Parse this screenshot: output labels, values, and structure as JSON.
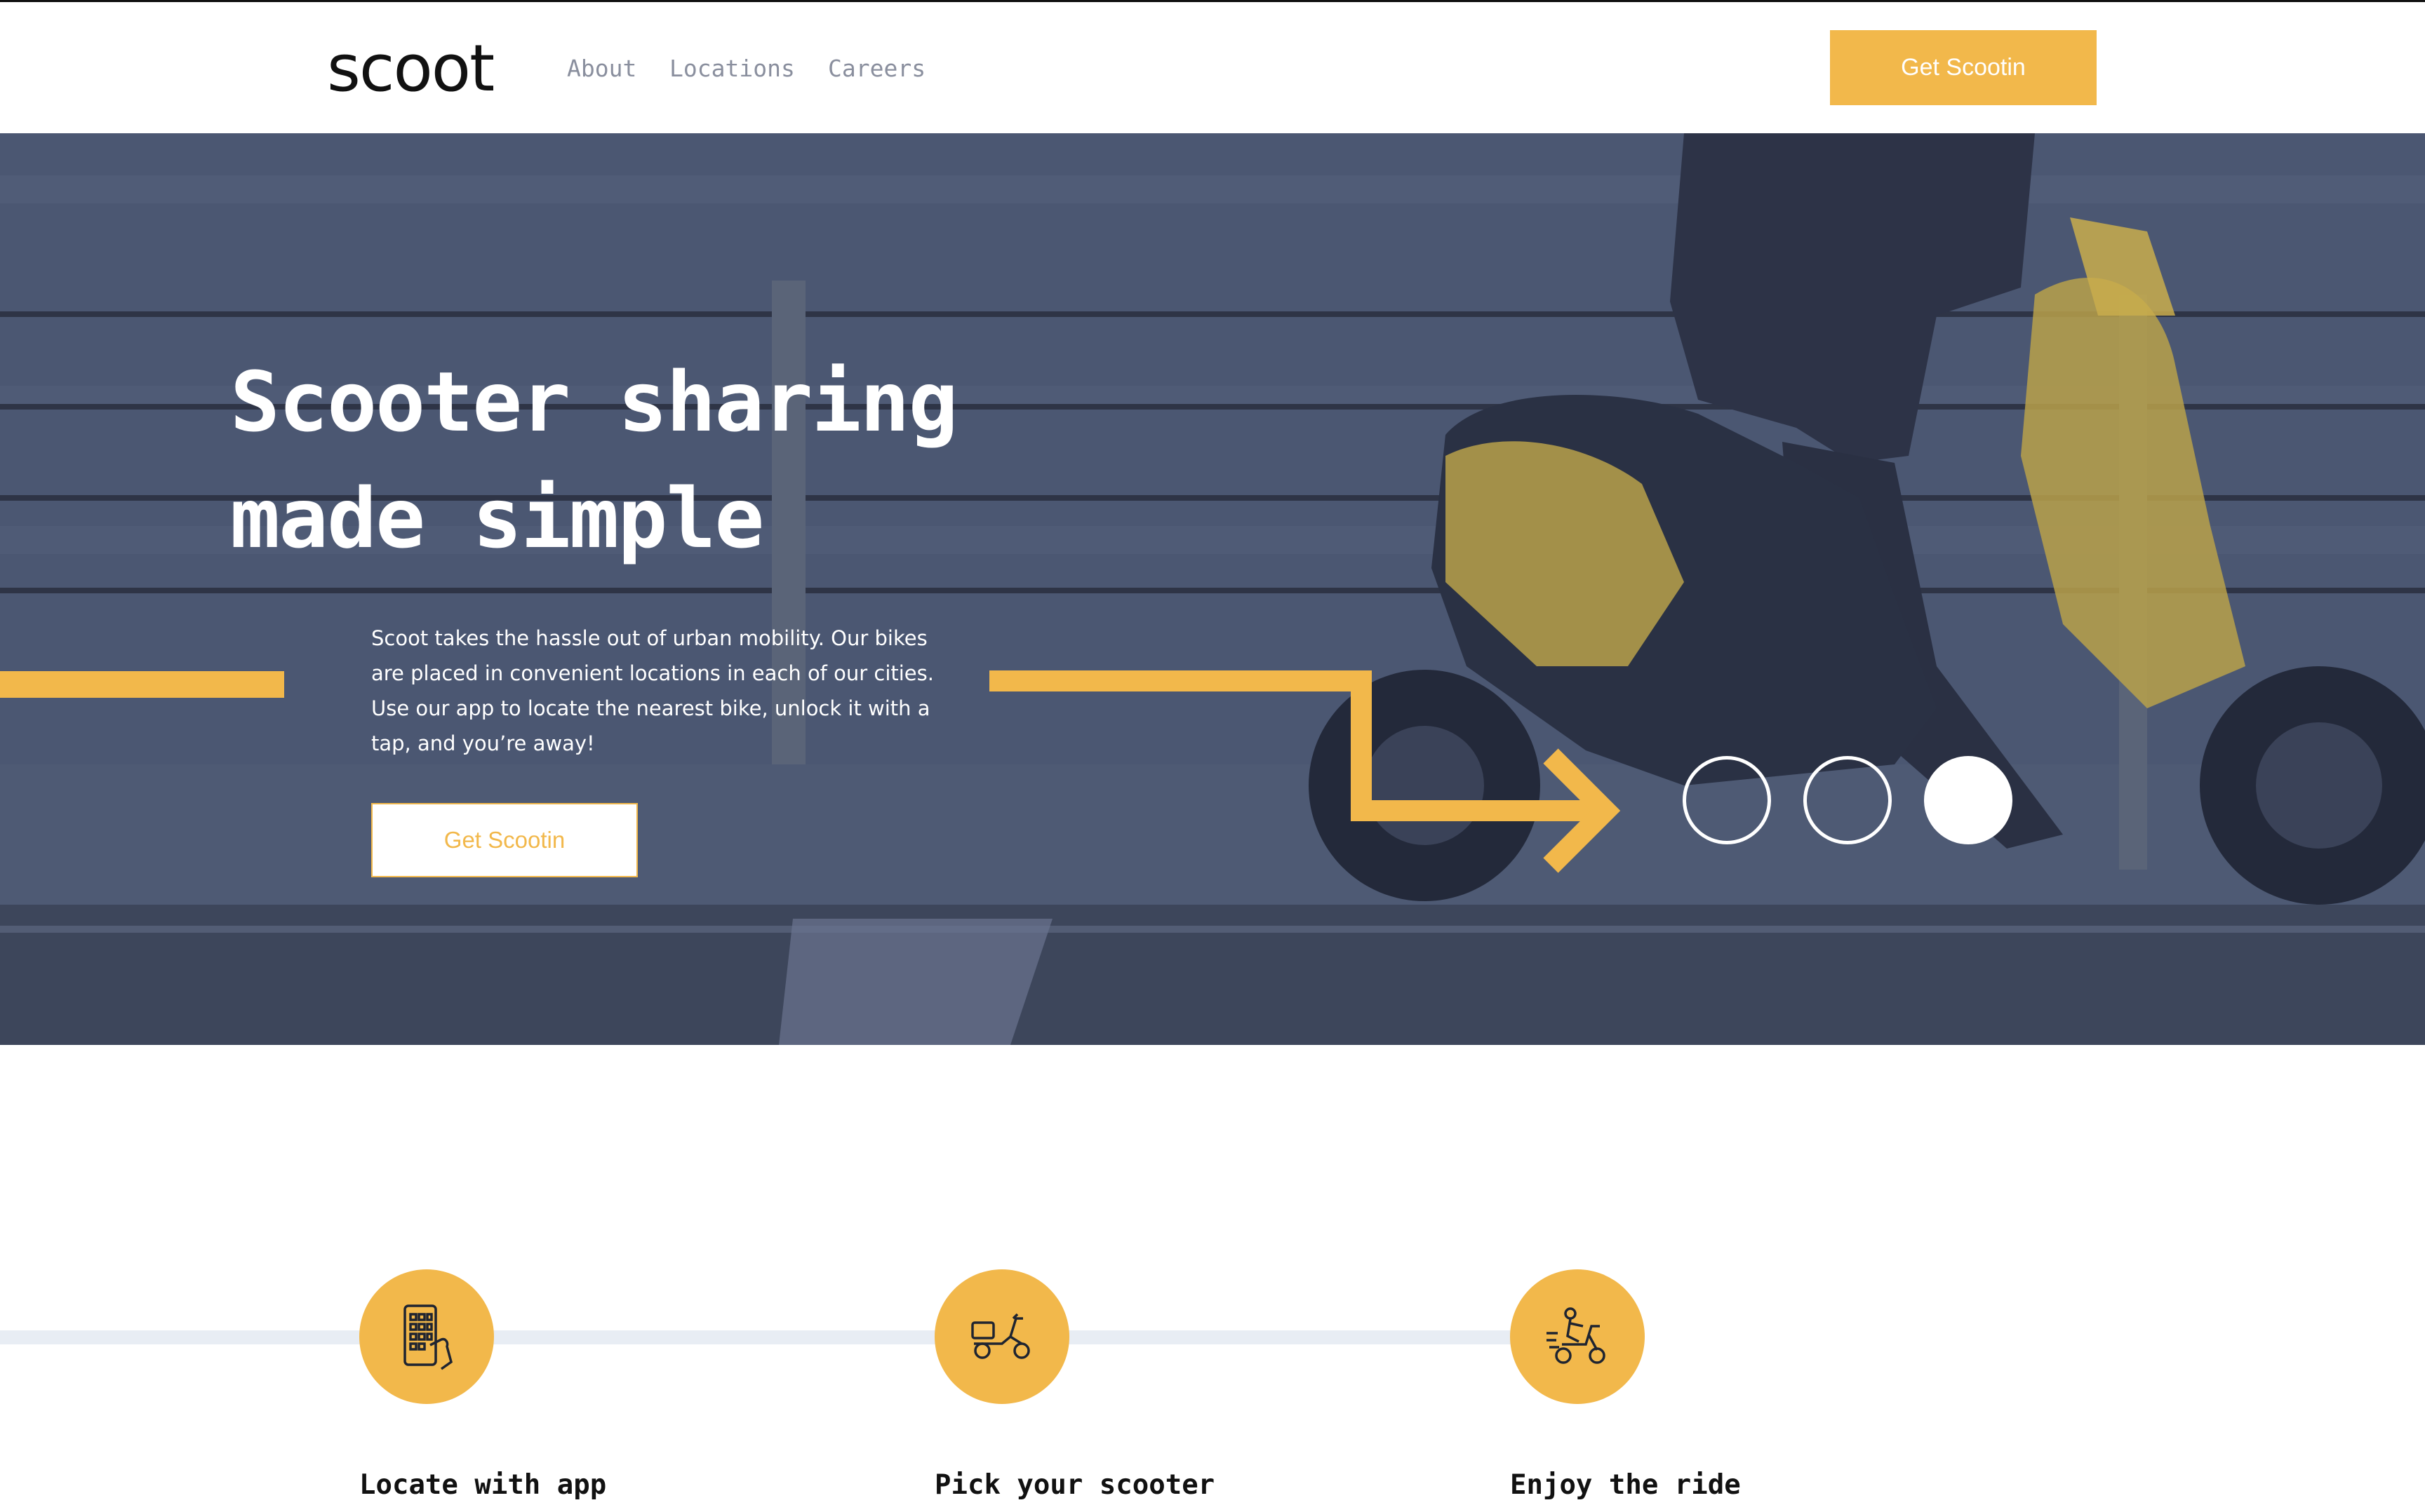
{
  "header": {
    "logo": "scoot",
    "nav": [
      {
        "label": "About"
      },
      {
        "label": "Locations"
      },
      {
        "label": "Careers"
      }
    ],
    "cta_label": "Get Scootin"
  },
  "hero": {
    "title_line1": "Scooter sharing",
    "title_line2": "made simple",
    "description": "Scoot takes the hassle out of urban mobility. Our bikes are placed in convenient locations in each of our cities. Use our app to locate the nearest bike, unlock it with a tap, and you’re away!",
    "cta_label": "Get Scootin",
    "carousel": {
      "slides": 3,
      "active_index": 3
    }
  },
  "steps": [
    {
      "title": "Locate with app",
      "icon": "phone-app-icon"
    },
    {
      "title": "Pick your scooter",
      "icon": "scooter-icon"
    },
    {
      "title": "Enjoy the ride",
      "icon": "rider-icon"
    }
  ],
  "colors": {
    "accent": "#f2b84b",
    "hero_overlay": "#4a5670",
    "text_dark": "#111111",
    "nav_text": "#8a8f9e",
    "steps_line": "#e8edf4"
  }
}
